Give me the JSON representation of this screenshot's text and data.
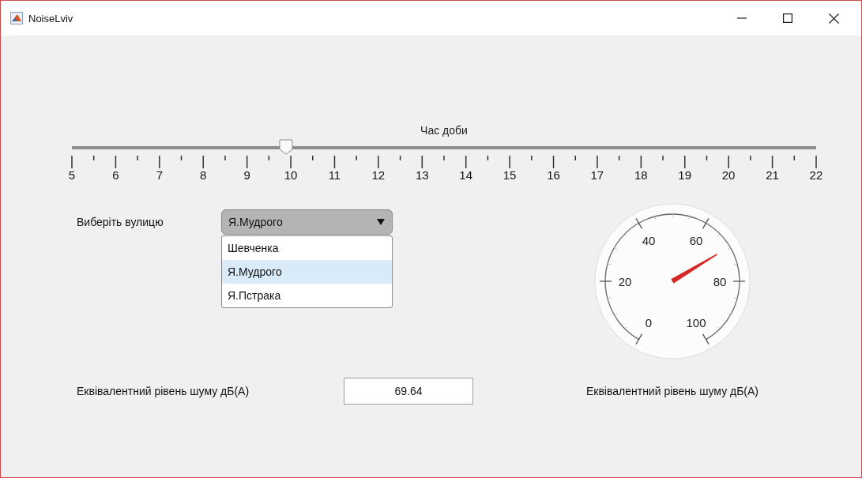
{
  "window": {
    "title": "NoiseLviv"
  },
  "time_slider": {
    "label": "Час доби",
    "level": 0.288,
    "ticks": [
      "5",
      "6",
      "7",
      "8",
      "9",
      "10",
      "11",
      "12",
      "13",
      "14",
      "15",
      "16",
      "17",
      "18",
      "19",
      "20",
      "21",
      "22"
    ]
  },
  "street": {
    "label": "Виберіть вулицю",
    "value": "Я.Мудрого",
    "expanded": true,
    "options": [
      {
        "label": "Шевченка",
        "selected": false
      },
      {
        "label": "Я.Мудрого",
        "selected": true
      },
      {
        "label": "Я.Пстрака",
        "selected": false
      }
    ]
  },
  "noise_output": {
    "label": "Еквівалентний рівень шуму дБ(А)",
    "value": "69.64"
  },
  "gauge": {
    "level": 0.6964,
    "ticks": [
      "0",
      "20",
      "40",
      "60",
      "80",
      "100"
    ],
    "label": "Еквівалентний рівень шуму дБ(А)"
  }
}
